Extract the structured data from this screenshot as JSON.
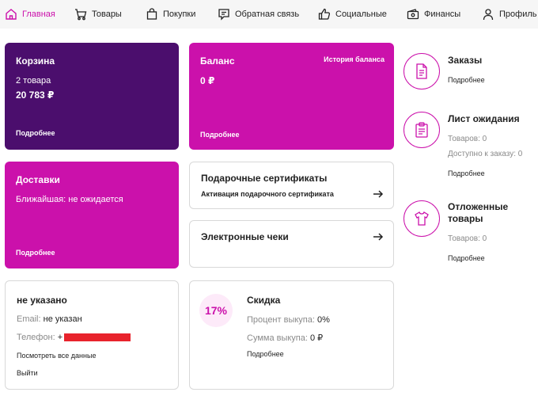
{
  "nav": {
    "items": [
      {
        "label": "Главная",
        "icon": "home-icon",
        "active": true
      },
      {
        "label": "Товары",
        "icon": "cart-icon"
      },
      {
        "label": "Покупки",
        "icon": "bag-icon"
      },
      {
        "label": "Обратная связь",
        "icon": "feedback-icon"
      },
      {
        "label": "Социальные",
        "icon": "thumbs-up-icon"
      },
      {
        "label": "Финансы",
        "icon": "wallet-icon"
      },
      {
        "label": "Профиль",
        "icon": "user-icon"
      }
    ]
  },
  "colors": {
    "accent": "#cb11ab",
    "violet": "#4b0e6d",
    "muted": "#8a8a8a",
    "redacted": "#e8232c"
  },
  "cart": {
    "title": "Корзина",
    "count": "2 товара",
    "sum": "20 783 ₽",
    "more": "Подробнее"
  },
  "balance": {
    "title": "Баланс",
    "history": "История баланса",
    "value": "0 ₽",
    "more": "Подробнее"
  },
  "deliveries": {
    "title": "Доставки",
    "nearest": "Ближайшая: не ожидается",
    "more": "Подробнее"
  },
  "gift": {
    "title": "Подарочные сертификаты",
    "activate": "Активация подарочного сертификата"
  },
  "receipts": {
    "title": "Электронные чеки"
  },
  "profile": {
    "name": "не указано",
    "email_label": "Email:",
    "email_value": "не указан",
    "phone_label": "Телефон:",
    "phone_value": "+",
    "see_all": "Посмотреть все данные",
    "logout": "Выйти"
  },
  "discount": {
    "percent": "17%",
    "title": "Скидка",
    "buyout_label": "Процент выкупа:",
    "buyout_value": "0%",
    "sum_label": "Сумма выкупа:",
    "sum_value": "0 ₽",
    "more": "Подробнее"
  },
  "orders": {
    "title": "Заказы",
    "more": "Подробнее"
  },
  "waitlist": {
    "title": "Лист ожидания",
    "goods": "Товаров: 0",
    "available": "Доступно к заказу: 0",
    "more": "Подробнее"
  },
  "postponed": {
    "title_line1": "Отложенные",
    "title_line2": "товары",
    "goods": "Товаров: 0",
    "more": "Подробнее"
  }
}
